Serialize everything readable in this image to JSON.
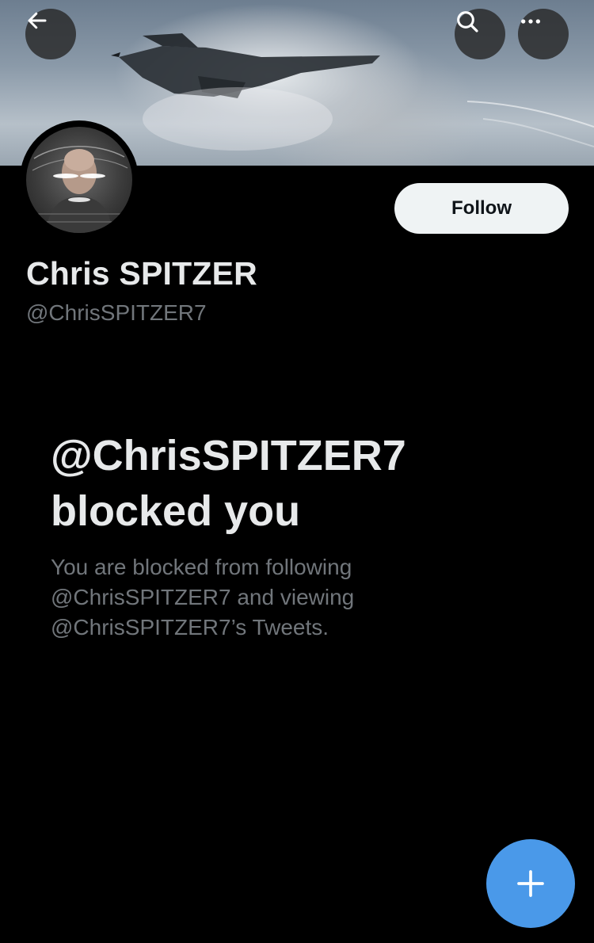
{
  "header": {
    "icons": {
      "back": "arrow-left-icon",
      "search": "search-icon",
      "more": "more-horizontal-icon"
    }
  },
  "profile": {
    "display_name": "Chris SPITZER",
    "handle": "@ChrisSPITZER7",
    "follow_label": "Follow"
  },
  "blocked": {
    "title_handle": "@ChrisSPITZER7",
    "title_rest": "blocked you",
    "description_line1": "You are blocked from following",
    "description_line2": "@ChrisSPITZER7 and viewing",
    "description_line3": "@ChrisSPITZER7’s Tweets."
  },
  "compose": {
    "icon": "plus-icon"
  },
  "colors": {
    "background": "#000000",
    "primary_text": "#e7e9ea",
    "secondary_text": "#71767b",
    "accent": "#4a99e9",
    "follow_bg": "#eff3f4"
  }
}
